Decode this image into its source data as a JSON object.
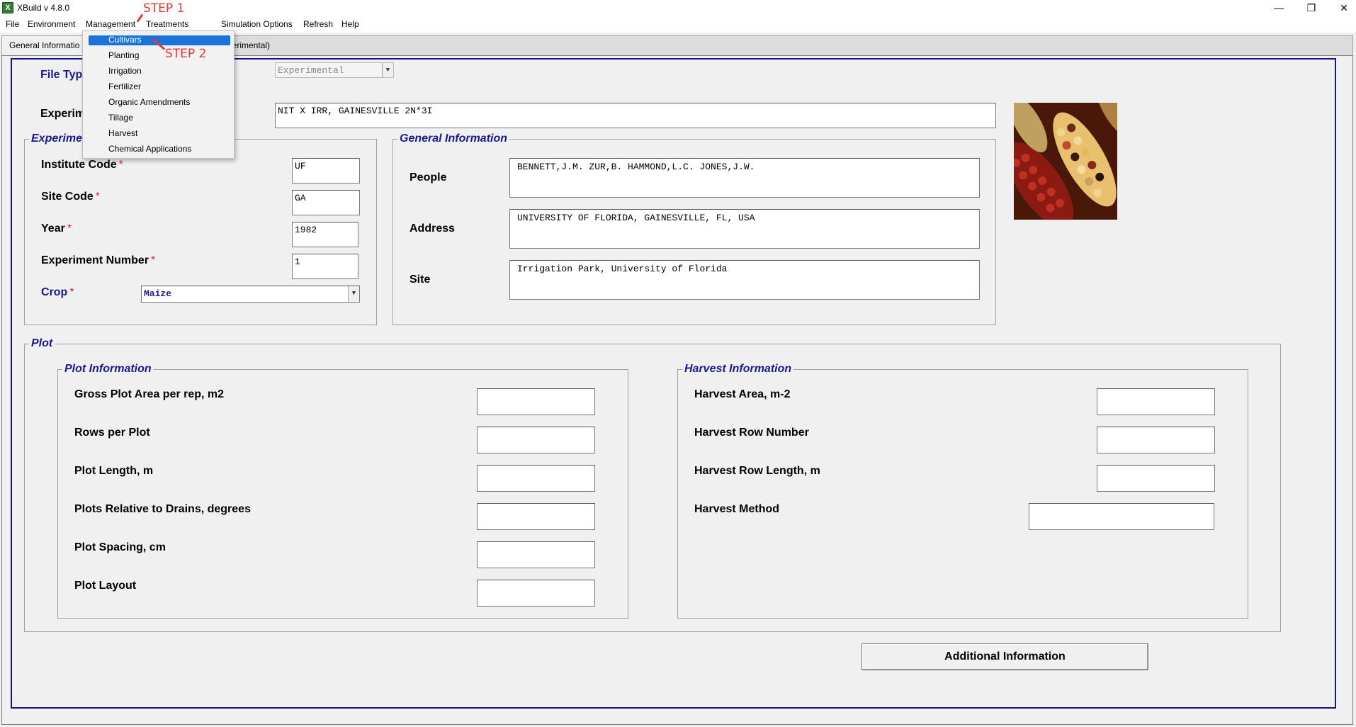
{
  "window": {
    "title": "XBuild v 4.8.0",
    "app_icon": "xbuild-icon",
    "controls": [
      "minimize-icon",
      "restore-icon",
      "close-icon"
    ]
  },
  "menubar": {
    "items": [
      "File",
      "Environment",
      "Management",
      "Treatments",
      "Simulation Options",
      "Refresh",
      "Help"
    ]
  },
  "annotations": {
    "step1": "STEP 1",
    "step2": "STEP 2",
    "color": "#e53935"
  },
  "management_menu": {
    "items": [
      "Cultivars",
      "Planting",
      "Irrigation",
      "Fertilizer",
      "Organic Amendments",
      "Tillage",
      "Harvest",
      "Chemical Applications"
    ],
    "highlighted": "Cultivars"
  },
  "tabs": {
    "active": "General Informatio",
    "second": "perimental)"
  },
  "form": {
    "file_type_label": "File Typ",
    "file_type_value": "Experimental",
    "experiment_label": "Experim",
    "experiment_value": "NIT X IRR, GAINESVILLE 2N*3I",
    "experiment_group_title": "Experime",
    "institute_code_label": "Institute Code",
    "institute_code_value": "UF",
    "site_code_label": "Site Code",
    "site_code_value": "GA",
    "year_label": "Year",
    "year_value": "1982",
    "experiment_number_label": "Experiment Number",
    "experiment_number_value": "1",
    "crop_label": "Crop",
    "crop_value": "Maize",
    "required_marker": "*"
  },
  "general_information": {
    "title": "General Information",
    "people_label": "People",
    "people_value": "BENNETT,J.M. ZUR,B. HAMMOND,L.C. JONES,J.W.",
    "address_label": "Address",
    "address_value": "UNIVERSITY OF FLORIDA, GAINESVILLE, FL, USA",
    "site_label": "Site",
    "site_value": "Irrigation Park, University of Florida"
  },
  "plot": {
    "title": "Plot",
    "plot_info": {
      "title": "Plot Information",
      "fields": [
        "Gross Plot Area per rep, m2",
        "Rows per Plot",
        "Plot Length, m",
        "Plots Relative to Drains, degrees",
        "Plot Spacing, cm",
        "Plot Layout"
      ]
    },
    "harvest_info": {
      "title": "Harvest Information",
      "fields": [
        "Harvest Area, m-2",
        "Harvest Row Number",
        "Harvest Row Length, m",
        "Harvest Method"
      ]
    }
  },
  "buttons": {
    "additional_information": "Additional Information"
  },
  "colors": {
    "frame_blue": "#14148c",
    "label_blue": "#1a1a8c",
    "required_red": "#d32f2f",
    "menu_highlight": "#1a73d9"
  }
}
